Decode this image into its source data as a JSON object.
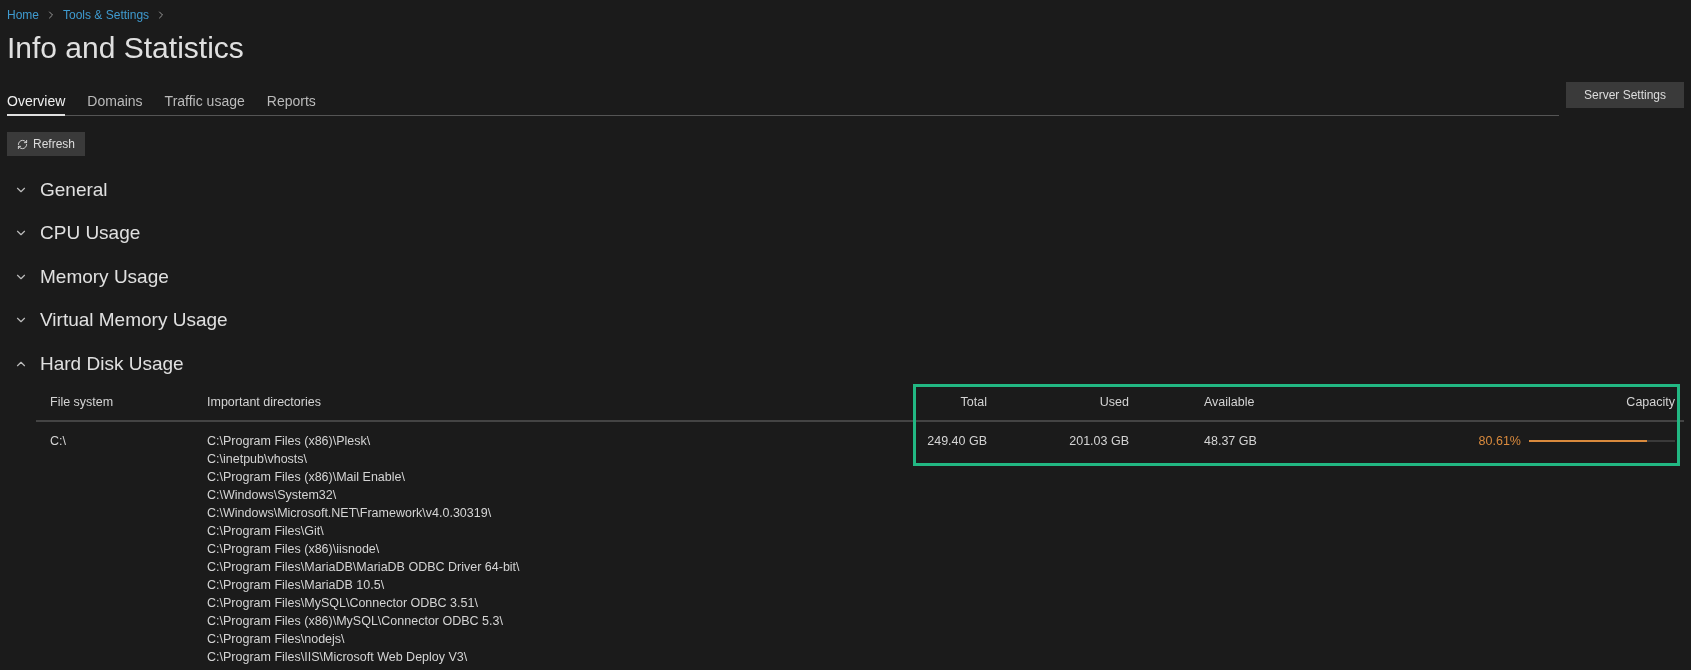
{
  "breadcrumbs": [
    "Home",
    "Tools & Settings"
  ],
  "title": "Info and Statistics",
  "tabs": [
    {
      "label": "Overview",
      "selected": true
    },
    {
      "label": "Domains",
      "selected": false
    },
    {
      "label": "Traffic usage",
      "selected": false
    },
    {
      "label": "Reports",
      "selected": false
    }
  ],
  "server_settings_button": "Server Settings",
  "refresh_button": "Refresh",
  "sections": [
    {
      "title": "General",
      "expanded": false
    },
    {
      "title": "CPU Usage",
      "expanded": false
    },
    {
      "title": "Memory Usage",
      "expanded": false
    },
    {
      "title": "Virtual Memory Usage",
      "expanded": false
    },
    {
      "title": "Hard Disk Usage",
      "expanded": true
    }
  ],
  "disk_table": {
    "columns": [
      "File system",
      "Important directories",
      "Total",
      "Used",
      "Available",
      "Capacity"
    ],
    "rows": [
      {
        "file_system": "C:\\",
        "directories": [
          "C:\\Program Files (x86)\\Plesk\\",
          "C:\\inetpub\\vhosts\\",
          "C:\\Program Files (x86)\\Mail Enable\\",
          "C:\\Windows\\System32\\",
          "C:\\Windows\\Microsoft.NET\\Framework\\v4.0.30319\\",
          "C:\\Program Files\\Git\\",
          "C:\\Program Files (x86)\\iisnode\\",
          "C:\\Program Files\\MariaDB\\MariaDB ODBC Driver 64-bit\\",
          "C:\\Program Files\\MariaDB 10.5\\",
          "C:\\Program Files\\MySQL\\Connector ODBC 3.51\\",
          "C:\\Program Files (x86)\\MySQL\\Connector ODBC 5.3\\",
          "C:\\Program Files\\nodejs\\",
          "C:\\Program Files\\IIS\\Microsoft Web Deploy V3\\"
        ],
        "total": "249.40 GB",
        "used": "201.03 GB",
        "available": "48.37 GB",
        "capacity": "80.61%",
        "level": 0.8061
      }
    ]
  }
}
